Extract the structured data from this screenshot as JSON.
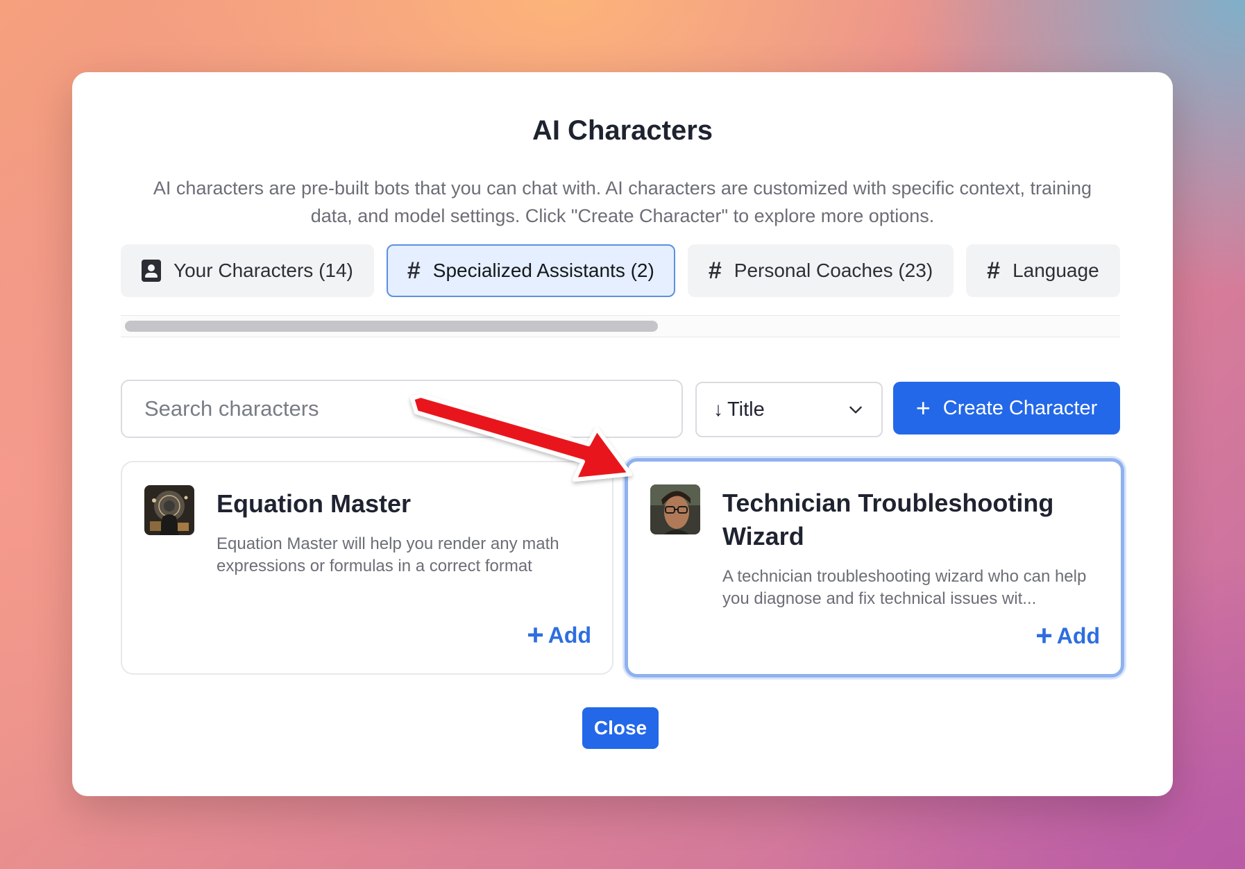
{
  "modal": {
    "title": "AI Characters",
    "description": "AI characters are pre-built bots that you can chat with. AI characters are customized with specific context, training data, and model settings. Click \"Create Character\" to explore more options."
  },
  "tabs": [
    {
      "label": "Your Characters (14)",
      "icon": "contact-icon",
      "active": false
    },
    {
      "label": "Specialized Assistants (2)",
      "icon": "hash-icon",
      "active": true
    },
    {
      "label": "Personal Coaches (23)",
      "icon": "hash-icon",
      "active": false
    },
    {
      "label": "Language",
      "icon": "hash-icon",
      "active": false
    }
  ],
  "toolbar": {
    "search_placeholder": "Search characters",
    "sort_label": "Title",
    "create_label": "Create Character"
  },
  "characters": [
    {
      "name": "Equation Master",
      "description": "Equation Master will help you render any math expressions or formulas in a correct format",
      "add_label": "Add"
    },
    {
      "name": "Technician Troubleshooting Wizard",
      "description": "A technician troubleshooting wizard who can help you diagnose and fix technical issues wit...",
      "add_label": "Add"
    }
  ],
  "footer": {
    "close_label": "Close"
  },
  "colors": {
    "primary": "#2368e8",
    "active_tab_bg": "#e5efff",
    "highlight_border": "#8fb1ee",
    "annotation_arrow": "#e8171c"
  }
}
